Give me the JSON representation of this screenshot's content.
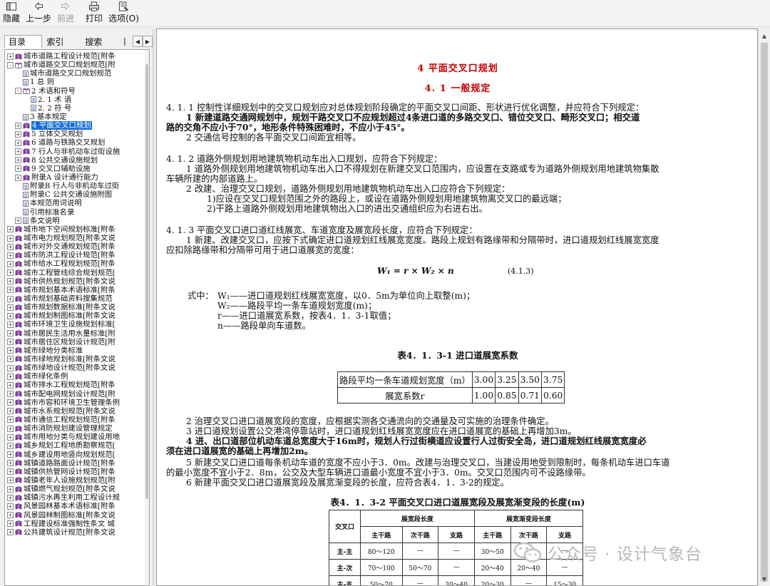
{
  "toolbar": {
    "hide": "隐藏",
    "back": "上一步",
    "forward": "前进",
    "print": "打印",
    "options": "选项(O)"
  },
  "nav": {
    "tabs": [
      "目录(C)",
      "索引(N)",
      "搜索(S)",
      "丨"
    ],
    "tree": [
      {
        "level": 0,
        "exp": "+",
        "icon": "book",
        "label": "城市道路工程设计规范[附条"
      },
      {
        "level": 0,
        "exp": "-",
        "icon": "book-open",
        "label": "城市道路交叉口规划规范[附"
      },
      {
        "level": 1,
        "exp": "",
        "icon": "page",
        "label": "城市道路交叉口规划规范"
      },
      {
        "level": 1,
        "exp": "",
        "icon": "page",
        "label": "1  总  则"
      },
      {
        "level": 1,
        "exp": "-",
        "icon": "book-open",
        "label": "2  术语和符号"
      },
      {
        "level": 2,
        "exp": "",
        "icon": "page",
        "label": "2. 1  术  语"
      },
      {
        "level": 2,
        "exp": "",
        "icon": "page",
        "label": "2. 2  符  号"
      },
      {
        "level": 1,
        "exp": "",
        "icon": "page",
        "label": "3  基本规定"
      },
      {
        "level": 1,
        "exp": "+",
        "icon": "book",
        "label": "4  平面交叉口规划",
        "selected": true
      },
      {
        "level": 1,
        "exp": "+",
        "icon": "book",
        "label": "5  立体交叉规划"
      },
      {
        "level": 1,
        "exp": "+",
        "icon": "book",
        "label": "6  道路与铁路交叉规划"
      },
      {
        "level": 1,
        "exp": "+",
        "icon": "book",
        "label": "7  行人与非机动车过街设施"
      },
      {
        "level": 1,
        "exp": "+",
        "icon": "book",
        "label": "8  公共交通设施规划"
      },
      {
        "level": 1,
        "exp": "+",
        "icon": "book",
        "label": "9  交叉口辅助设施"
      },
      {
        "level": 1,
        "exp": "+",
        "icon": "book",
        "label": "附录A  设计通行能力"
      },
      {
        "level": 1,
        "exp": "",
        "icon": "page",
        "label": "附录B  行人与非机动车过街"
      },
      {
        "level": 1,
        "exp": "",
        "icon": "page",
        "label": "附录C  公共交通设施附图"
      },
      {
        "level": 1,
        "exp": "",
        "icon": "page",
        "label": "本规范用词说明"
      },
      {
        "level": 1,
        "exp": "",
        "icon": "page",
        "label": "引用标准名录"
      },
      {
        "level": 1,
        "exp": "+",
        "icon": "page",
        "label": "条文说明"
      },
      {
        "level": 0,
        "exp": "+",
        "icon": "book",
        "label": "城市地下空间规划标准[附条"
      },
      {
        "level": 0,
        "exp": "+",
        "icon": "book",
        "label": "城市电力规划规范[附条文说"
      },
      {
        "level": 0,
        "exp": "+",
        "icon": "book",
        "label": "城市对外交通规划规范[附条"
      },
      {
        "level": 0,
        "exp": "+",
        "icon": "book",
        "label": "城市防洪工程设计规范[附条"
      },
      {
        "level": 0,
        "exp": "+",
        "icon": "book",
        "label": "城市给水工程规划规范[附条"
      },
      {
        "level": 0,
        "exp": "+",
        "icon": "book",
        "label": "城市工程管线综合规划规范["
      },
      {
        "level": 0,
        "exp": "+",
        "icon": "book",
        "label": "城市供热规划规范[附条文说"
      },
      {
        "level": 0,
        "exp": "+",
        "icon": "book",
        "label": "城市规划基本术语标准[附条"
      },
      {
        "level": 0,
        "exp": "+",
        "icon": "book",
        "label": "城市规划基础资料搜集规范"
      },
      {
        "level": 0,
        "exp": "+",
        "icon": "book",
        "label": "城市规划数据标准[附条文说"
      },
      {
        "level": 0,
        "exp": "+",
        "icon": "book",
        "label": "城市规划制图标准[附条文说"
      },
      {
        "level": 0,
        "exp": "+",
        "icon": "book",
        "label": "城市环境卫生设施规划标准["
      },
      {
        "level": 0,
        "exp": "+",
        "icon": "book",
        "label": "城市居民生活用水量标准[附"
      },
      {
        "level": 0,
        "exp": "+",
        "icon": "book",
        "label": "城市居住区规划设计规范[附"
      },
      {
        "level": 0,
        "exp": "+",
        "icon": "book",
        "label": "城市绿地分类标准"
      },
      {
        "level": 0,
        "exp": "+",
        "icon": "book",
        "label": "城市绿地规划标准[附条文说"
      },
      {
        "level": 0,
        "exp": "+",
        "icon": "book",
        "label": "城市绿地设计规范[附条文说"
      },
      {
        "level": 0,
        "exp": "+",
        "icon": "book",
        "label": "城市绿化条例"
      },
      {
        "level": 0,
        "exp": "+",
        "icon": "book",
        "label": "城市排水工程规划规范[附条"
      },
      {
        "level": 0,
        "exp": "+",
        "icon": "book",
        "label": "城市配电网规划设计规范[附"
      },
      {
        "level": 0,
        "exp": "+",
        "icon": "book",
        "label": "城市市容和环境卫生管理条例"
      },
      {
        "level": 0,
        "exp": "+",
        "icon": "book",
        "label": "城市水系规划规范[附条文说"
      },
      {
        "level": 0,
        "exp": "+",
        "icon": "book",
        "label": "城市通信工程规划规范[附条"
      },
      {
        "level": 0,
        "exp": "+",
        "icon": "book",
        "label": "城市消防规划建设管理规定"
      },
      {
        "level": 0,
        "exp": "+",
        "icon": "book",
        "label": "城市用地分类与规划建设用地"
      },
      {
        "level": 0,
        "exp": "+",
        "icon": "book",
        "label": "城乡规划工程地质勘察规范["
      },
      {
        "level": 0,
        "exp": "+",
        "icon": "book",
        "label": "城乡建设用地竖向规划规范["
      },
      {
        "level": 0,
        "exp": "+",
        "icon": "book",
        "label": "城镇道路路面设计规范[附条"
      },
      {
        "level": 0,
        "exp": "+",
        "icon": "book",
        "label": "城镇供热管网设计规范[附条"
      },
      {
        "level": 0,
        "exp": "+",
        "icon": "book",
        "label": "城镇老年人设施规划规范[附"
      },
      {
        "level": 0,
        "exp": "+",
        "icon": "book",
        "label": "城镇燃气规划规范[附条文说"
      },
      {
        "level": 0,
        "exp": "+",
        "icon": "book",
        "label": "城镇污水再生利用工程设计规"
      },
      {
        "level": 0,
        "exp": "+",
        "icon": "book",
        "label": "风景园林基本术语标准[附条"
      },
      {
        "level": 0,
        "exp": "+",
        "icon": "book",
        "label": "风景园林制图标准[附条文说"
      },
      {
        "level": 0,
        "exp": "+",
        "icon": "book",
        "label": "工程建设标准强制性条文  城"
      },
      {
        "level": 0,
        "exp": "+",
        "icon": "book",
        "label": "公共建筑设计规范[附条文说"
      }
    ]
  },
  "content": {
    "h1": "4  平面交叉口规划",
    "h2": "4. 1  一般规定",
    "s411": "4. 1. 1  控制性详细规划中的交叉口规划应对总体规划阶段确定的平面交叉口间距、形状进行优化调整，并应符合下列规定：",
    "s411_1a": "1  新建道路交通网规划中，规划干路交叉口不应规划超过4条进口道的多路交叉口、错位交叉口、畸形交叉口；相交道",
    "s411_1b": "路的交角不应小于70°，地形条件特殊困难时，不应小于45°。",
    "s411_2": "2  交通信号控制的各平面交叉口间距宜相等。",
    "s412": "4. 1. 2  道路外侧规划用地建筑物机动车出入口规划，应符合下列规定：",
    "s412_1a": "1  道路外侧规划用地建筑物机动车出入口不得规划在新建交叉口范围内，应设置在支路或专为道路外侧规划用地建筑物集散",
    "s412_1b": "车辆所建的内部道路上。",
    "s412_2": "2  改建、治理交叉口规划，道路外侧规划用地建筑物机动车出入口应符合下列规定：",
    "s412_2_1": "1)应设在交叉口规划范围之外的路段上，或设在道路外侧规划用地建筑物离交叉口的最远端；",
    "s412_2_2": "2)干路上道路外侧规划用地建筑物出入口的进出交通组织应为右进右出。",
    "s413": "4. 1. 3  平面交叉口进口道红线展宽、车道宽度及展宽段长度，应符合下列规定：",
    "s413_1a": "1  新建、改建交叉口，应按下式确定进口道规划红线展宽宽度。路段上规划有路缘带和分隔带时，进口道规划红线展宽宽度",
    "s413_1b": "应扣除路缘带和分隔带可用于进口道展宽的宽度：",
    "formula": "W₁ = r × W₂ × n",
    "formula_no": "(4.1.3)",
    "where": "式中：",
    "w1": "W₁——进口道规划红线展宽宽度，以0．5m为单位向上取整(m)；",
    "w2": "W₂——路段平均一条车道规划宽度(m)；",
    "r": "r——进口道展宽系数，按表4．1．3-1取值；",
    "n": "n——路段单向车道数。",
    "t1_title": "表4．1．3-1  进口道展宽系数",
    "t1": {
      "row1_label": "路段平均一条车道规划宽度（m）",
      "row1": [
        "3.00",
        "3.25",
        "3.50",
        "3.75"
      ],
      "row2_label": "展宽系数r",
      "row2": [
        "1.00",
        "0.85",
        "0.71",
        "0.60"
      ]
    },
    "s413_2": "2  治理交叉口进口道展宽段的宽度，应根据实测各交通流向的交通量及可实施的治理条件确定。",
    "s413_3": "3  进口道规划设置公交港湾停靠站时，进口道规划红线展宽宽度应在进口道展宽的基础上再增加3m。",
    "s413_4a": "4  进、出口道部位机动车道总宽度大于16m时，规划人行过街横道应设置行人过街安全岛，进口道规划红线展宽宽度必",
    "s413_4b": "须在进口道展宽的基础上再增加2m。",
    "s413_5a": "5  新建交叉口进口道每条机动车道的宽度不应小于3．0m。改建与治理交叉口，当建设用地受到限制时，每条机动车进口车道",
    "s413_5b": "的最小宽度不宜小于2．8m，公交及大型车辆进口道最小宽度不宜小于3．0m。交叉口范围内可不设路缘带。",
    "s413_6": "6  新建平面交叉口进口道展宽段及展宽渐变段的长度，应符合表4．1．3-2的规定。",
    "t2_title": "表4．1．3-2  平面交叉口进口道展宽段及展宽渐变段的长度(m)",
    "t2": {
      "c0": "交叉口",
      "g1": "展宽段长度",
      "g2": "展宽渐变段长度",
      "sub": [
        "主干路",
        "次干路",
        "支路",
        "主干路",
        "次干路",
        "支路"
      ],
      "rows": [
        [
          "主-主",
          "80～120",
          "—",
          "—",
          "30～50",
          "—",
          "—"
        ],
        [
          "主-次",
          "70～100",
          "50～70",
          "—",
          "20～40",
          "20～40",
          "—"
        ],
        [
          "主-支",
          "50～70",
          "—",
          "30～40",
          "20～30",
          "—",
          "15～30"
        ]
      ]
    }
  },
  "watermark": "公众号 · 设计气象台"
}
